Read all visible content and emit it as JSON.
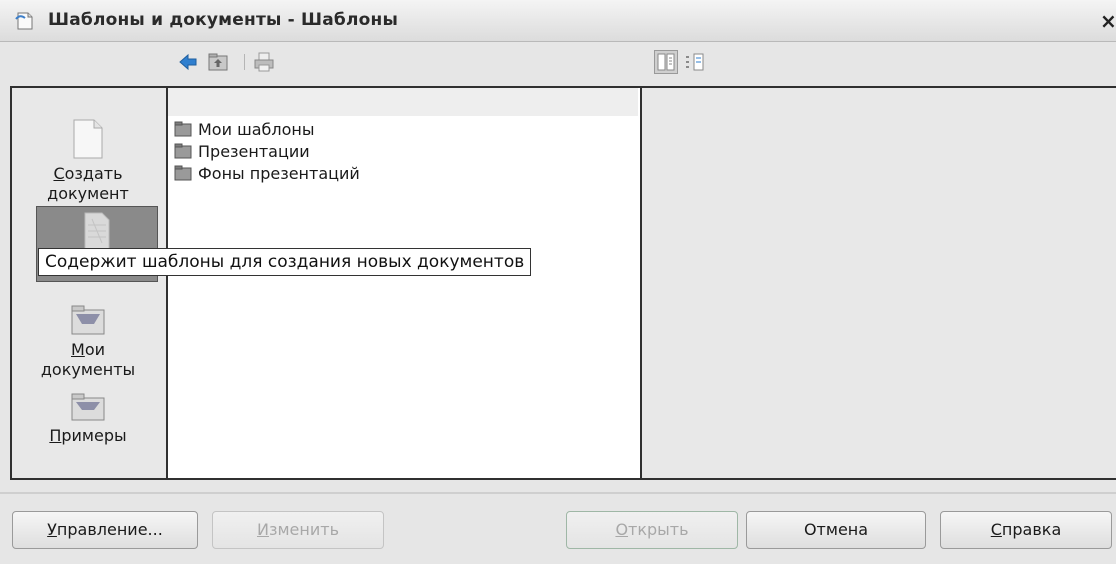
{
  "window": {
    "title": "Шаблоны и документы - Шаблоны",
    "close_glyph": "×"
  },
  "toolbar": {
    "buttons": [
      {
        "name": "back-arrow-icon"
      },
      {
        "name": "folder-up-icon"
      },
      {
        "name": "print-icon"
      }
    ],
    "view_buttons": [
      {
        "name": "preview-view-icon"
      },
      {
        "name": "document-properties-icon"
      }
    ]
  },
  "sidebar": {
    "items": [
      {
        "label_mnemonic": "С",
        "label_rest": "оздать",
        "label_line2": "документ",
        "icon": "new-document-icon"
      },
      {
        "label_mnemonic": "",
        "label_rest": "",
        "label_line2": "",
        "icon": "templates-icon",
        "selected": true
      },
      {
        "label_mnemonic": "М",
        "label_rest": "ои",
        "label_line2": "документы",
        "icon": "my-documents-folder-icon"
      },
      {
        "label_mnemonic": "П",
        "label_rest": "римеры",
        "label_line2": "",
        "icon": "examples-folder-icon"
      }
    ]
  },
  "folders": [
    {
      "label": "Мои шаблоны"
    },
    {
      "label": "Презентации"
    },
    {
      "label": "Фоны презентаций"
    }
  ],
  "tooltip": {
    "text": "Содержит шаблоны для создания новых документов"
  },
  "buttons": {
    "manage": {
      "mnemonic": "У",
      "rest": "правление..."
    },
    "edit": {
      "mnemonic": "И",
      "rest": "зменить",
      "disabled": true
    },
    "open": {
      "mnemonic": "О",
      "rest": "ткрыть",
      "disabled": true
    },
    "cancel": {
      "label": "Отмена"
    },
    "help": {
      "mnemonic": "С",
      "rest": "правка"
    }
  },
  "colors": {
    "accent_arrow": "#2f7fcf",
    "selected_bg": "#8a8a8a",
    "panel_border": "#303030"
  }
}
